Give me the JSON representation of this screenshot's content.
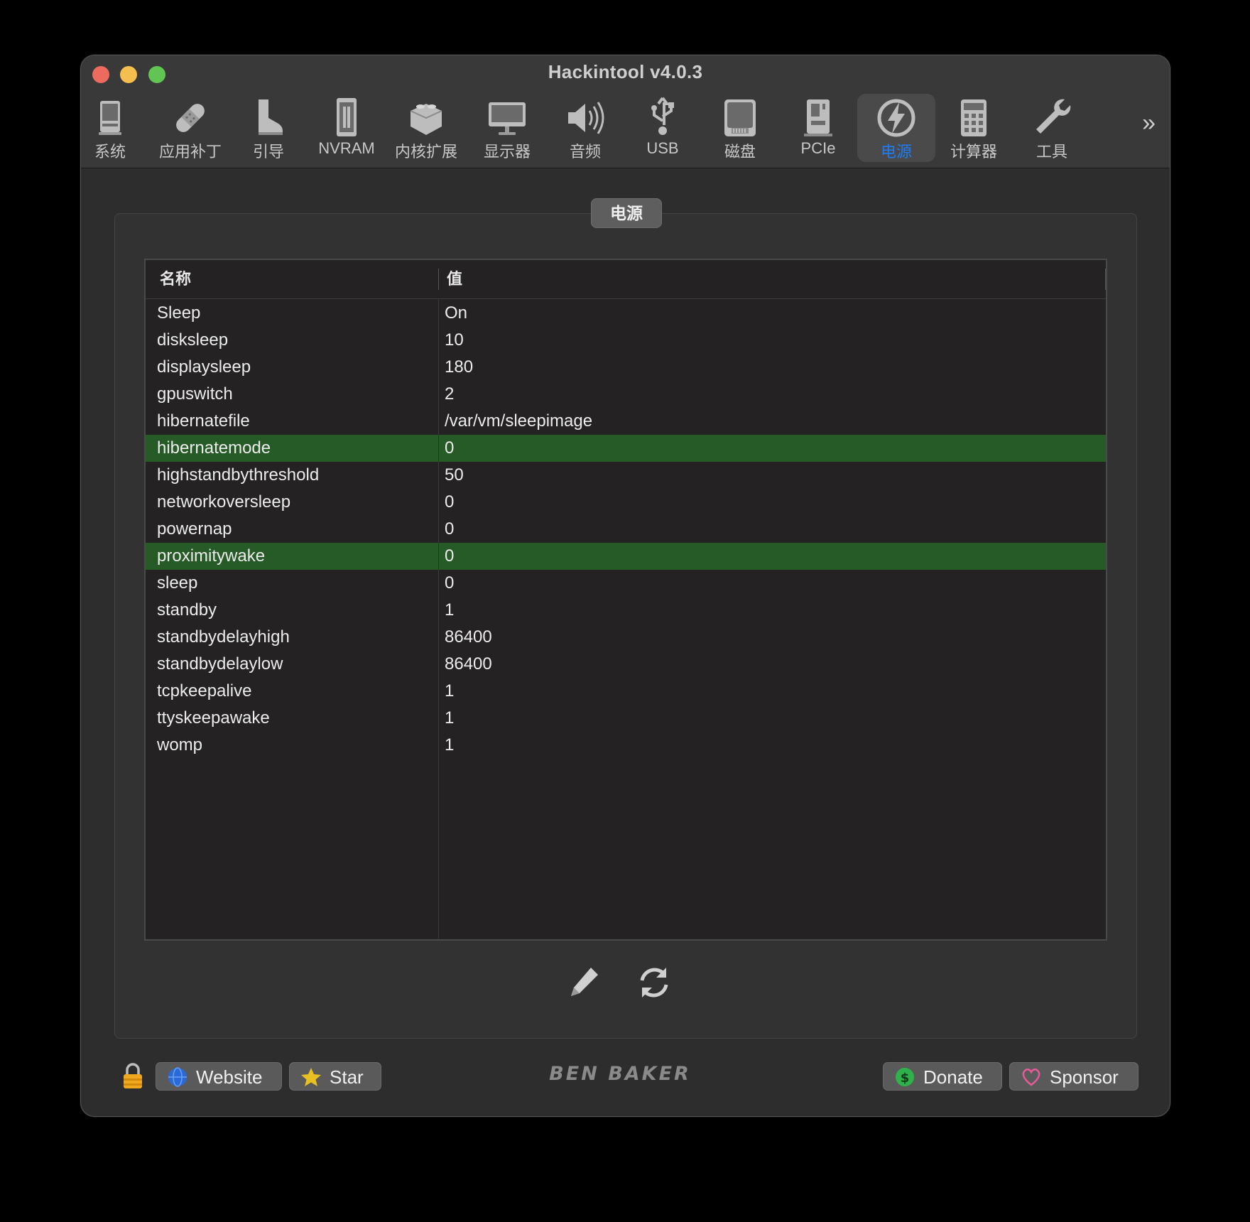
{
  "window": {
    "title": "Hackintool v4.0.3"
  },
  "toolbar": {
    "items": [
      {
        "label": "系统",
        "icon": "system-icon"
      },
      {
        "label": "应用补丁",
        "icon": "patch-icon"
      },
      {
        "label": "引导",
        "icon": "boot-icon"
      },
      {
        "label": "NVRAM",
        "icon": "nvram-icon"
      },
      {
        "label": "内核扩展",
        "icon": "kext-icon"
      },
      {
        "label": "显示器",
        "icon": "display-icon"
      },
      {
        "label": "音频",
        "icon": "audio-icon"
      },
      {
        "label": "USB",
        "icon": "usb-icon"
      },
      {
        "label": "磁盘",
        "icon": "disk-icon"
      },
      {
        "label": "PCIe",
        "icon": "pcie-icon"
      },
      {
        "label": "电源",
        "icon": "power-icon",
        "active": true
      },
      {
        "label": "计算器",
        "icon": "calculator-icon"
      },
      {
        "label": "工具",
        "icon": "tools-icon"
      }
    ],
    "more": "»"
  },
  "group": {
    "label": "电源"
  },
  "table": {
    "columns": [
      "名称",
      "值"
    ],
    "rows": [
      {
        "name": "Sleep",
        "value": "On"
      },
      {
        "name": "disksleep",
        "value": "10"
      },
      {
        "name": "displaysleep",
        "value": "180"
      },
      {
        "name": "gpuswitch",
        "value": "2"
      },
      {
        "name": "hibernatefile",
        "value": "/var/vm/sleepimage"
      },
      {
        "name": "hibernatemode",
        "value": "0",
        "selected": true
      },
      {
        "name": "highstandbythreshold",
        "value": "50"
      },
      {
        "name": "networkoversleep",
        "value": "0"
      },
      {
        "name": "powernap",
        "value": "0"
      },
      {
        "name": "proximitywake",
        "value": "0",
        "selected": true
      },
      {
        "name": "sleep",
        "value": "0"
      },
      {
        "name": "standby",
        "value": "1"
      },
      {
        "name": "standbydelayhigh",
        "value": "86400"
      },
      {
        "name": "standbydelaylow",
        "value": "86400"
      },
      {
        "name": "tcpkeepalive",
        "value": "1"
      },
      {
        "name": "ttyskeepawake",
        "value": "1"
      },
      {
        "name": "womp",
        "value": "1"
      }
    ]
  },
  "footer": {
    "website": "Website",
    "star": "Star",
    "brand": "BEN BAKER",
    "donate": "Donate",
    "sponsor": "Sponsor"
  },
  "colors": {
    "selected_row": "#265a27",
    "active_tab_text": "#1e7cf5"
  }
}
